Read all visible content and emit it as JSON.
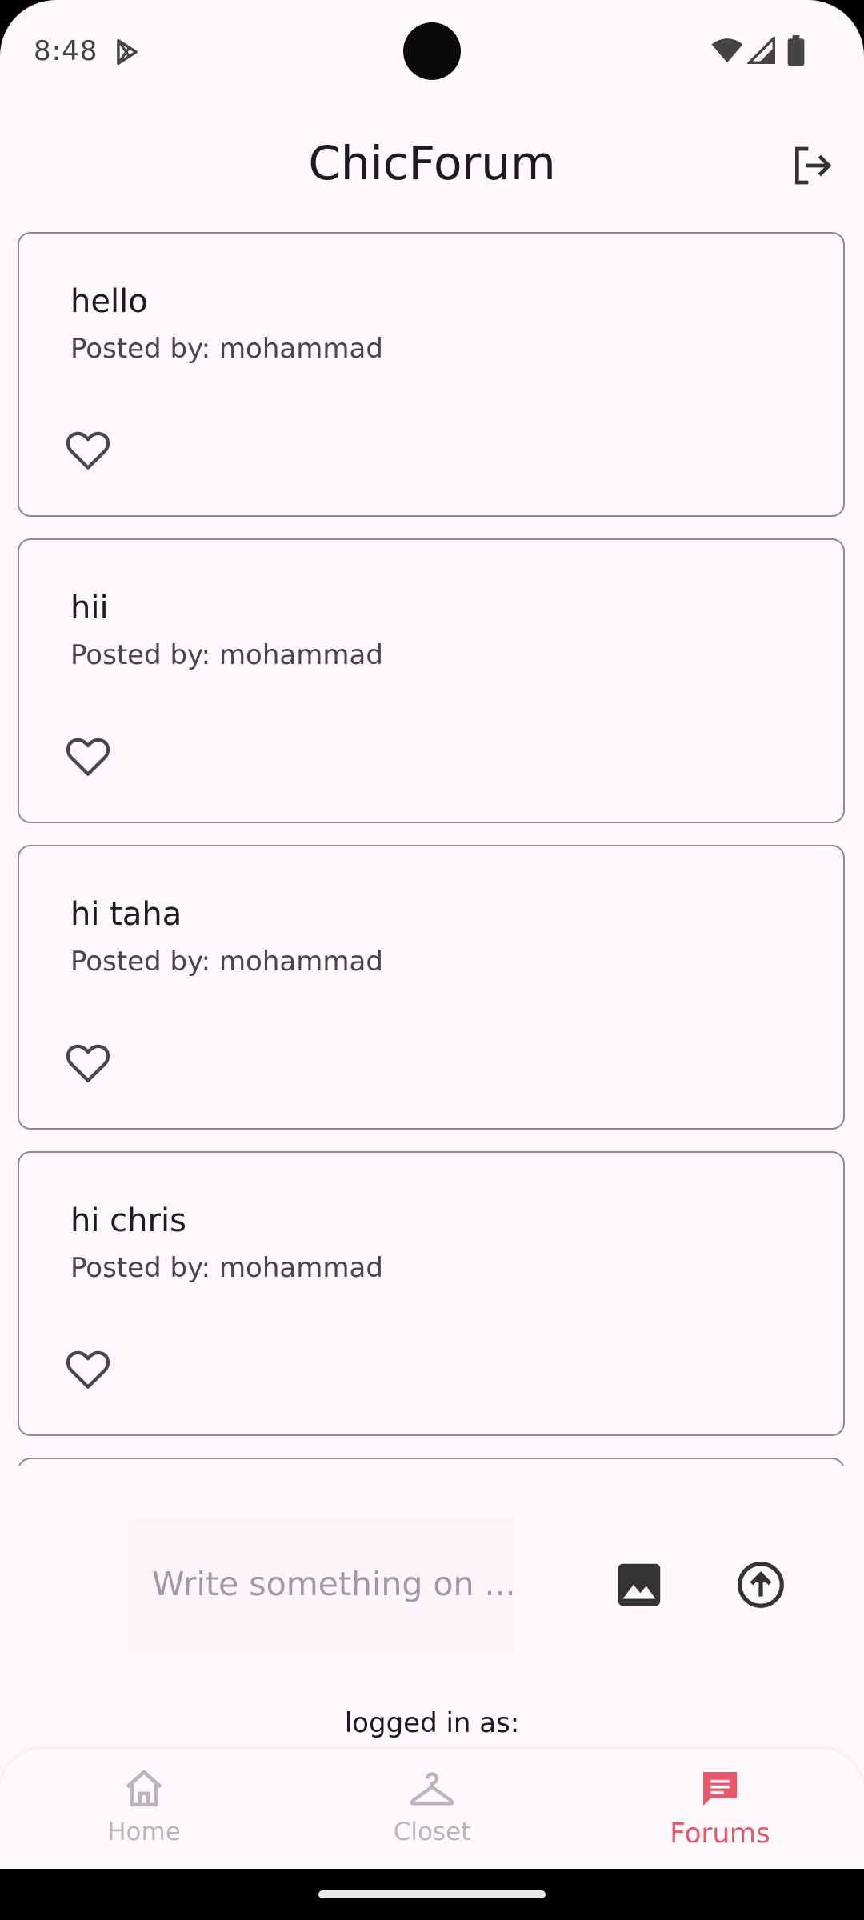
{
  "status_bar": {
    "time": "8:48"
  },
  "app_bar": {
    "title": "ChicForum"
  },
  "posts": [
    {
      "title": "hello",
      "author": "Posted by: mohammad"
    },
    {
      "title": "hii",
      "author": "Posted by: mohammad"
    },
    {
      "title": "hi taha",
      "author": "Posted by: mohammad"
    },
    {
      "title": "hi chris",
      "author": "Posted by: mohammad"
    }
  ],
  "composer": {
    "placeholder": "Write something on ..."
  },
  "footer": {
    "logged_in_label": "logged in as:"
  },
  "bottom_nav": {
    "items": [
      {
        "label": "Home",
        "icon": "home-icon"
      },
      {
        "label": "Closet",
        "icon": "hanger-icon"
      },
      {
        "label": "Forums",
        "icon": "chat-icon"
      }
    ],
    "active": "Forums"
  },
  "colors": {
    "background": "#FEF8FC",
    "accent": "#E8566A",
    "card_border": "#8E8C92",
    "inactive": "#B9B6BB"
  }
}
